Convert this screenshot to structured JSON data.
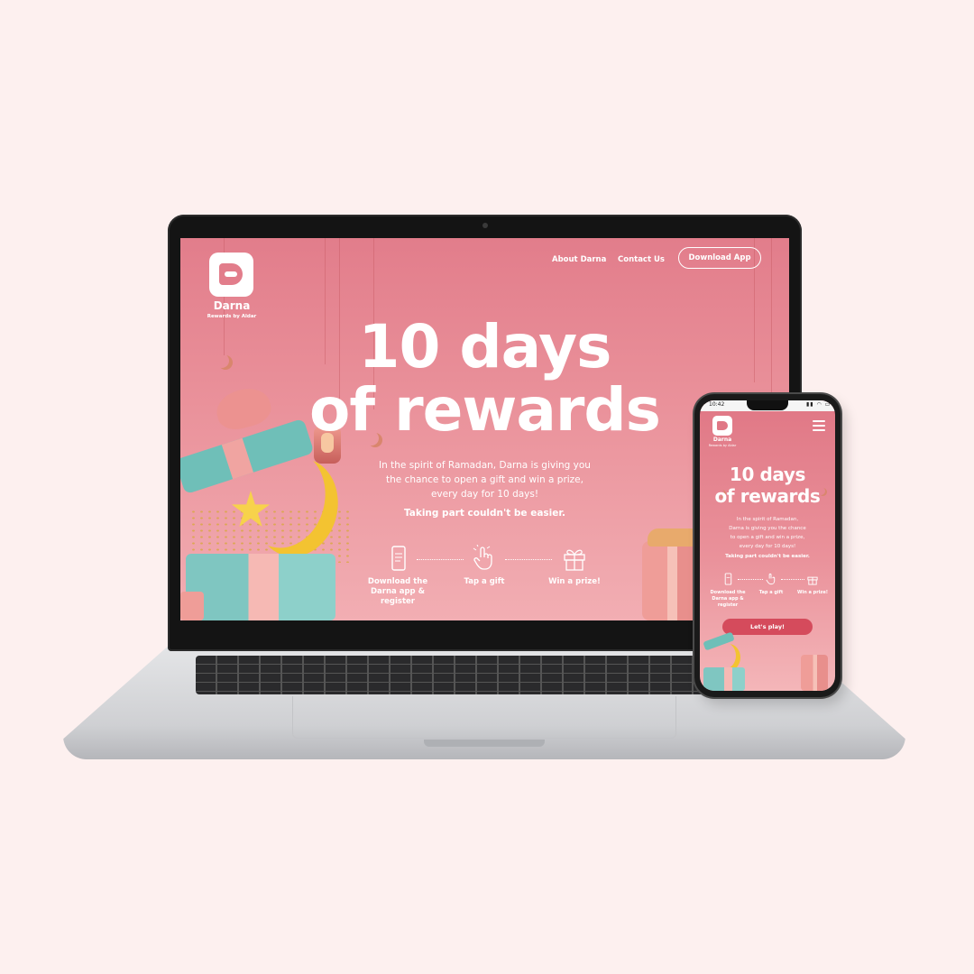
{
  "brand": {
    "name": "Darna",
    "tagline": "Rewards by Aldar",
    "accent": "#e27d8b",
    "cta_color": "#d54b5c"
  },
  "desktop": {
    "nav": {
      "about": "About Darna",
      "contact": "Contact Us",
      "download": "Download App"
    },
    "hero_line1": "10 days",
    "hero_line2": "of rewards",
    "subtitle_line1": "In the spirit of Ramadan, Darna is giving you",
    "subtitle_line2": "the chance to open a gift and win a prize,",
    "subtitle_line3": "every day for 10 days!",
    "emphasis": "Taking part couldn't be easier.",
    "steps": [
      {
        "label_line1": "Download the",
        "label_line2": "Darna app & register",
        "icon": "phone-icon"
      },
      {
        "label_line1": "Tap a gift",
        "label_line2": "",
        "icon": "tap-hand-icon"
      },
      {
        "label_line1": "Win a prize!",
        "label_line2": "",
        "icon": "gift-icon"
      }
    ]
  },
  "mobile": {
    "status_time": "10:42",
    "status_icons": "▮▮ ◠ ▭",
    "hero_line1": "10 days",
    "hero_line2": "of rewards",
    "subtitle_line1": "In the spirit of Ramadan,",
    "subtitle_line2": "Darna is giving you the chance",
    "subtitle_line3": "to open a gift and win a prize,",
    "subtitle_line4": "every day for 10 days!",
    "emphasis": "Taking part couldn't be easier.",
    "steps": [
      {
        "label_line1": "Download the",
        "label_line2": "Darna app &",
        "label_line3": "register"
      },
      {
        "label_line1": "Tap a gift",
        "label_line2": "",
        "label_line3": ""
      },
      {
        "label_line1": "Win a prize!",
        "label_line2": "",
        "label_line3": ""
      }
    ],
    "cta": "Let's play!"
  }
}
